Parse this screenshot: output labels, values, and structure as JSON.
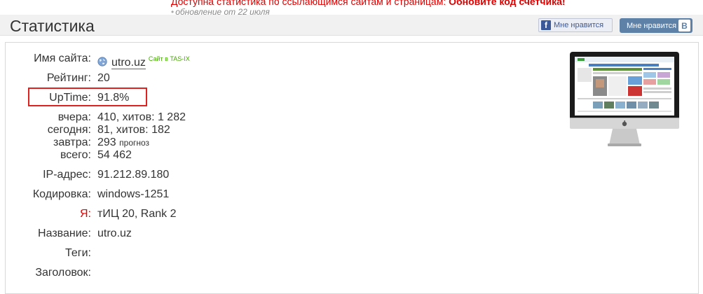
{
  "notice": {
    "text": "Доступна статистика по ссылающимся сайтам и страницам:",
    "link": "Обновите код счетчика!",
    "date": "обновление от 22 июля"
  },
  "header": {
    "title": "Статистика",
    "fb_like": "Мне нравится",
    "vk_like": "Мне нравится",
    "vk_icon": "B"
  },
  "stats": {
    "site_name_label": "Имя сайта:",
    "site_name_value": "utro.uz",
    "tasix": "Сайт в TAS-IX",
    "rating_label": "Рейтинг:",
    "rating_value": "20",
    "uptime_label": "UpTime:",
    "uptime_value": "91.8%",
    "yesterday_label": "вчера:",
    "yesterday_value": "410, хитов: 1 282",
    "today_label": "сегодня:",
    "today_value": "81, хитов: 182",
    "tomorrow_label": "завтра:",
    "tomorrow_value": "293",
    "tomorrow_note": "прогноз",
    "total_label": "всего:",
    "total_value": "54 462",
    "ip_label": "IP-адрес:",
    "ip_value": "91.212.89.180",
    "encoding_label": "Кодировка:",
    "encoding_value": "windows-1251",
    "ya_label": "Я:",
    "ya_value": "тИЦ 20, Rank 2",
    "title_label": "Название:",
    "title_value": "utro.uz",
    "tags_label": "Теги:",
    "heading_label": "Заголовок:"
  },
  "icons": {
    "globe": "globe-icon",
    "fb": "facebook-icon",
    "vk": "vk-icon",
    "preview": "site-preview-imac",
    "apple": "apple-logo-icon"
  },
  "colors": {
    "notice": "#dd0000",
    "highlight": "#dd2222",
    "tasix": "#44aa00",
    "vk": "#5e81a8",
    "fb": "#3b5998"
  }
}
